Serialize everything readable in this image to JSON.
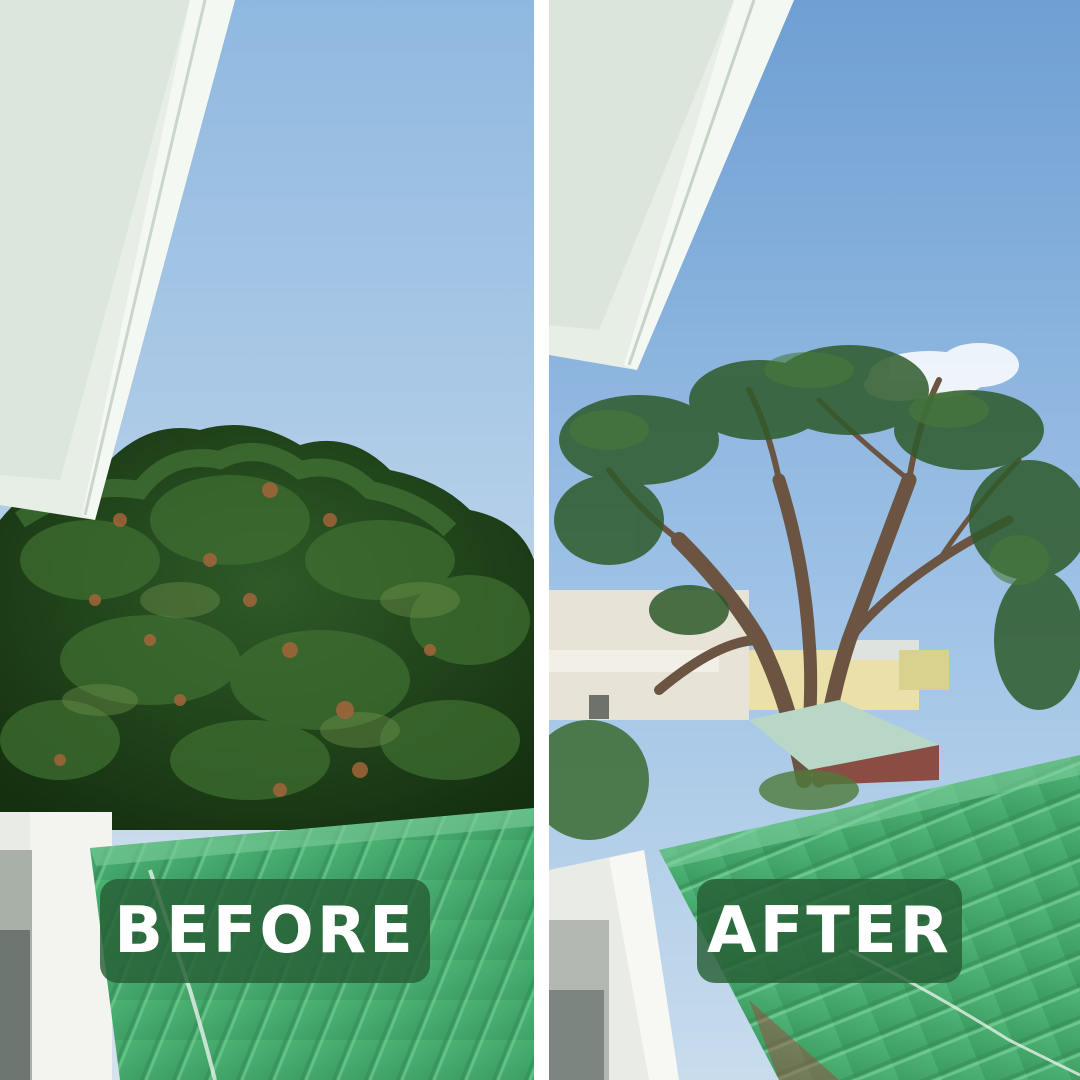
{
  "labels": {
    "before": "BEFORE",
    "after": "AFTER"
  },
  "colors": {
    "label_background": "#265e34",
    "label_text": "#ffffff",
    "roof_green": "#4fb776",
    "sky_blue": "#a9c9e4"
  }
}
